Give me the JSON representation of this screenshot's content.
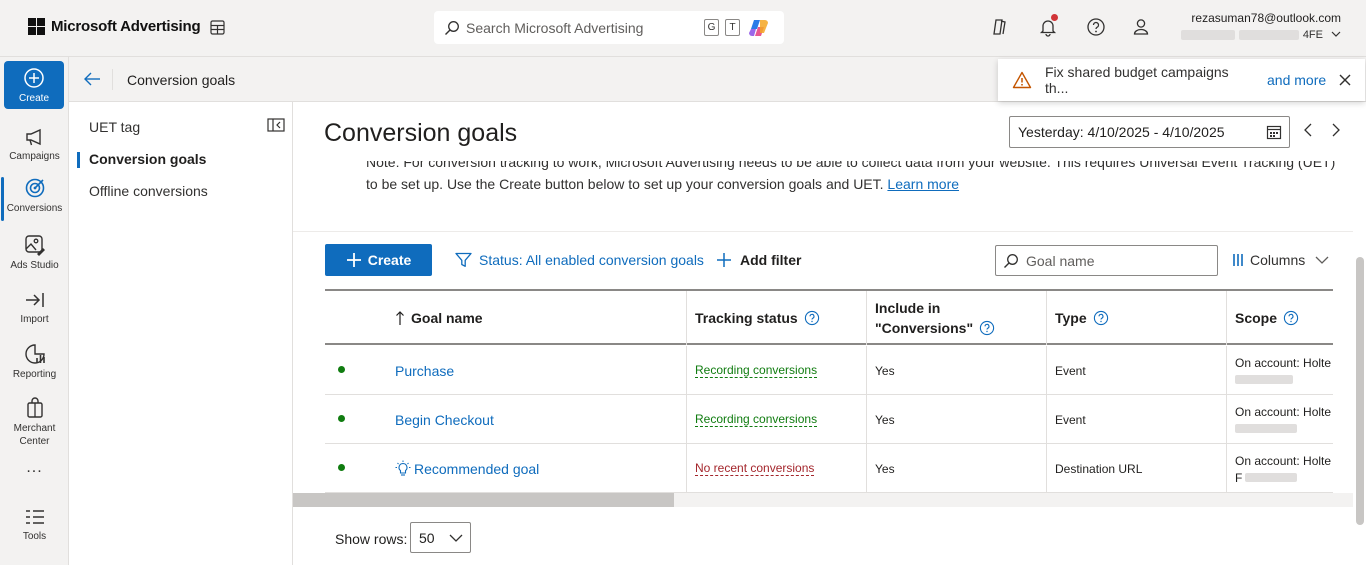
{
  "app": {
    "brand": "Microsoft Advertising",
    "search_placeholder": "Search Microsoft Advertising",
    "kbd_g": "G",
    "kbd_t": "T",
    "account_email": "rezasuman78@outlook.com",
    "account_id_suffix": "4FE"
  },
  "rail": {
    "create": "Create",
    "items": [
      {
        "label": "Campaigns"
      },
      {
        "label": "Conversions"
      },
      {
        "label": "Ads Studio"
      },
      {
        "label": "Import"
      },
      {
        "label": "Reporting"
      },
      {
        "label": "Merchant Center"
      },
      {
        "label": "..."
      },
      {
        "label": "Tools"
      }
    ]
  },
  "subheader": {
    "title": "Conversion goals"
  },
  "toast": {
    "message": "Fix shared budget campaigns th...",
    "more": "and more"
  },
  "secnav": {
    "items": [
      {
        "label": "UET tag"
      },
      {
        "label": "Conversion goals"
      },
      {
        "label": "Offline conversions"
      }
    ]
  },
  "main": {
    "title": "Conversion goals",
    "date_range": "Yesterday: 4/10/2025 - 4/10/2025",
    "note_line1": "Note: For conversion tracking to work, Microsoft Advertising needs to be able to collect data from your website. This requires Universal Event Tracking (UET)",
    "note_line2": "to be set up. Use the Create button below to set up your conversion goals and UET.",
    "learn_more": "Learn more"
  },
  "toolbar": {
    "create": "Create",
    "status_filter": "Status: All enabled conversion goals",
    "add_filter": "Add filter",
    "goal_search_placeholder": "Goal name",
    "columns": "Columns"
  },
  "table": {
    "headers": {
      "goal_name": "Goal name",
      "tracking_status": "Tracking status",
      "include_line1": "Include in",
      "include_line2": "\"Conversions\"",
      "type": "Type",
      "scope": "Scope"
    },
    "rows": [
      {
        "goal": "Purchase",
        "tracking": "Recording conversions",
        "include": "Yes",
        "type": "Event",
        "scope": "On account: Holte"
      },
      {
        "goal": "Begin Checkout",
        "tracking": "Recording conversions",
        "include": "Yes",
        "type": "Event",
        "scope": "On account: Holte"
      },
      {
        "goal": "Recommended goal",
        "tracking": "No recent conversions",
        "include": "Yes",
        "type": "Destination URL",
        "scope": "On account: Holte",
        "scope_line2": "F"
      }
    ]
  },
  "pagination": {
    "show_rows_label": "Show rows:",
    "rows_value": "50"
  }
}
